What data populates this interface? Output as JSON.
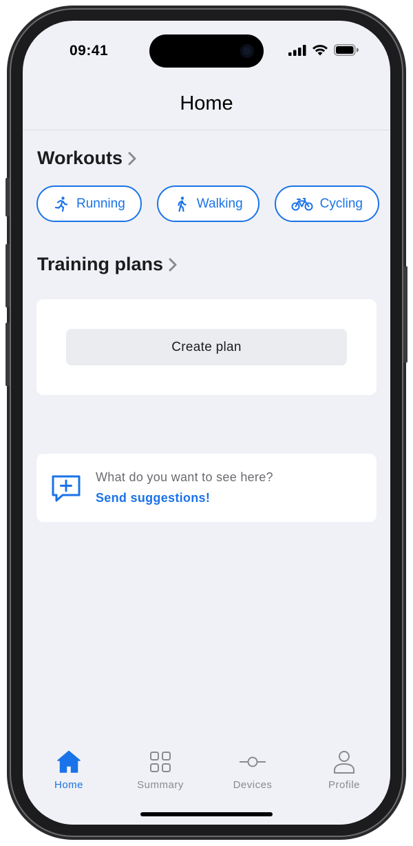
{
  "status_bar": {
    "time": "09:41"
  },
  "header": {
    "title": "Home"
  },
  "workouts": {
    "title": "Workouts",
    "chips": [
      {
        "label": "Running",
        "icon": "running-icon"
      },
      {
        "label": "Walking",
        "icon": "walking-icon"
      },
      {
        "label": "Cycling",
        "icon": "cycling-icon"
      }
    ]
  },
  "training_plans": {
    "title": "Training plans",
    "create_label": "Create plan"
  },
  "suggestions": {
    "question": "What do you want to see here?",
    "link": "Send suggestions!"
  },
  "tabbar": {
    "tabs": [
      {
        "label": "Home",
        "icon": "home-icon",
        "active": true
      },
      {
        "label": "Summary",
        "icon": "grid-icon",
        "active": false
      },
      {
        "label": "Devices",
        "icon": "devices-icon",
        "active": false
      },
      {
        "label": "Profile",
        "icon": "person-icon",
        "active": false
      }
    ]
  },
  "colors": {
    "accent": "#1a73e8",
    "background": "#f0f1f6",
    "card": "#ffffff"
  }
}
